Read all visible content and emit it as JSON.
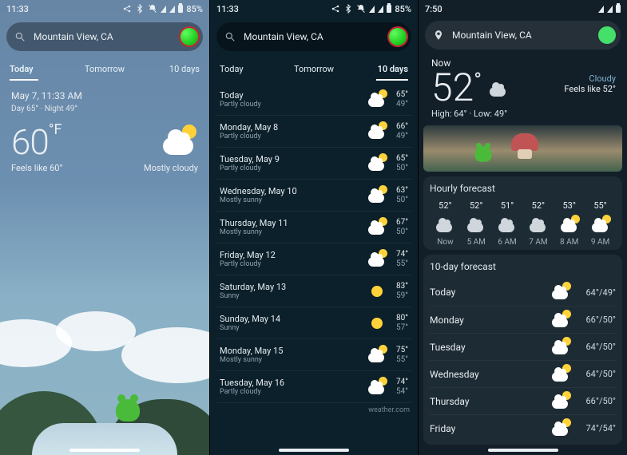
{
  "status": {
    "time_a": "11:33",
    "time_b": "11:33",
    "time_c": "7:50",
    "battery": "85%"
  },
  "search": {
    "location": "Mountain View, CA"
  },
  "tabs": {
    "today": "Today",
    "tomorrow": "Tomorrow",
    "tendays": "10 days"
  },
  "pane1": {
    "datetime": "May 7, 11:33 AM",
    "hilo": "Day 65° · Night 49°",
    "temp": "60",
    "unit": "°F",
    "feels": "Feels like 60°",
    "condition": "Mostly cloudy"
  },
  "pane2": {
    "days": [
      {
        "day": "Today",
        "cond": "Partly cloudy",
        "hi": "65°",
        "lo": "49°",
        "icon": "pc"
      },
      {
        "day": "Monday, May 8",
        "cond": "Partly cloudy",
        "hi": "66°",
        "lo": "49°",
        "icon": "pc"
      },
      {
        "day": "Tuesday, May 9",
        "cond": "Partly cloudy",
        "hi": "65°",
        "lo": "50°",
        "icon": "pc"
      },
      {
        "day": "Wednesday, May 10",
        "cond": "Mostly sunny",
        "hi": "63°",
        "lo": "50°",
        "icon": "ms"
      },
      {
        "day": "Thursday, May 11",
        "cond": "Mostly sunny",
        "hi": "67°",
        "lo": "50°",
        "icon": "ms"
      },
      {
        "day": "Friday, May 12",
        "cond": "Partly cloudy",
        "hi": "74°",
        "lo": "55°",
        "icon": "pc"
      },
      {
        "day": "Saturday, May 13",
        "cond": "Sunny",
        "hi": "83°",
        "lo": "59°",
        "icon": "sun"
      },
      {
        "day": "Sunday, May 14",
        "cond": "Sunny",
        "hi": "80°",
        "lo": "57°",
        "icon": "sun"
      },
      {
        "day": "Monday, May 15",
        "cond": "Mostly sunny",
        "hi": "75°",
        "lo": "55°",
        "icon": "ms"
      },
      {
        "day": "Tuesday, May 16",
        "cond": "Partly cloudy",
        "hi": "74°",
        "lo": "54°",
        "icon": "pc"
      }
    ],
    "attribution": "weather.com"
  },
  "pane3": {
    "now_label": "Now",
    "temp": "52",
    "deg": "°",
    "condition": "Cloudy",
    "feels": "Feels like 52°",
    "hilo": "High: 64° · Low: 49°",
    "hourly_title": "Hourly forecast",
    "hourly": [
      {
        "t": "52°",
        "h": "Now",
        "icon": "cloudy"
      },
      {
        "t": "52°",
        "h": "5 AM",
        "icon": "cloudy"
      },
      {
        "t": "51°",
        "h": "6 AM",
        "icon": "cloudy"
      },
      {
        "t": "52°",
        "h": "7 AM",
        "icon": "cloudy"
      },
      {
        "t": "53°",
        "h": "8 AM",
        "icon": "pc"
      },
      {
        "t": "55°",
        "h": "9 AM",
        "icon": "pc"
      }
    ],
    "ten_title": "10-day forecast",
    "ten": [
      {
        "day": "Today",
        "rng": "64°/49°",
        "icon": "pc"
      },
      {
        "day": "Monday",
        "rng": "66°/50°",
        "icon": "pc"
      },
      {
        "day": "Tuesday",
        "rng": "64°/50°",
        "icon": "pc"
      },
      {
        "day": "Wednesday",
        "rng": "64°/50°",
        "icon": "pc"
      },
      {
        "day": "Thursday",
        "rng": "66°/50°",
        "icon": "pc"
      },
      {
        "day": "Friday",
        "rng": "74°/54°",
        "icon": "pc"
      }
    ]
  }
}
